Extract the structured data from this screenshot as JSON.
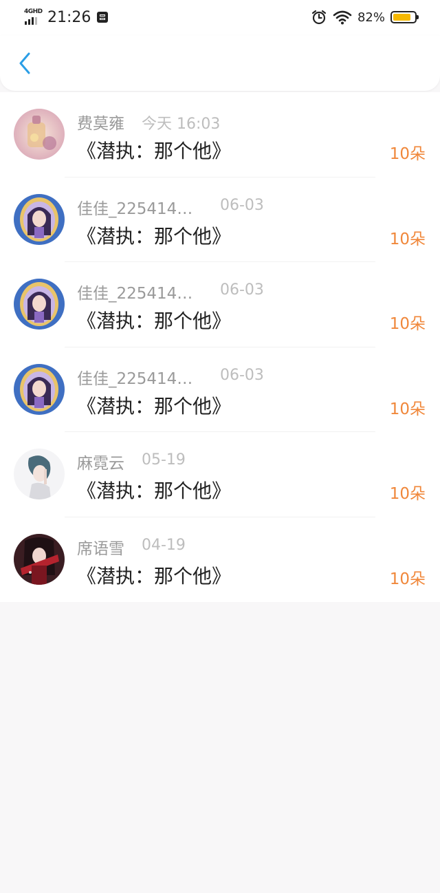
{
  "status_bar": {
    "network": "4GHD",
    "time": "21:26",
    "battery_percent": "82%",
    "battery_level": 0.82,
    "icons": [
      "signal-icon",
      "notification-icon",
      "alarm-icon",
      "wifi-icon",
      "battery-icon"
    ]
  },
  "nav": {
    "back_icon": "chevron-left-icon",
    "accent_color": "#2a9ee6"
  },
  "gifts": [
    {
      "name": "费莫雍",
      "date": "今天 16:03",
      "title": "《潜执：那个他》",
      "amount": "10朵"
    },
    {
      "name": "佳佳_225414…",
      "date": "06-03",
      "title": "《潜执：那个他》",
      "amount": "10朵"
    },
    {
      "name": "佳佳_225414…",
      "date": "06-03",
      "title": "《潜执：那个他》",
      "amount": "10朵"
    },
    {
      "name": "佳佳_225414…",
      "date": "06-03",
      "title": "《潜执：那个他》",
      "amount": "10朵"
    },
    {
      "name": "麻霓云",
      "date": "05-19",
      "title": "《潜执：那个他》",
      "amount": "10朵"
    },
    {
      "name": "席语雪",
      "date": "04-19",
      "title": "《潜执：那个他》",
      "amount": "10朵"
    }
  ],
  "colors": {
    "amount": "#f0873a",
    "name": "#9a9a9a",
    "date": "#bdbdbd",
    "title": "#222222",
    "page_background": "#f8f7f8"
  }
}
